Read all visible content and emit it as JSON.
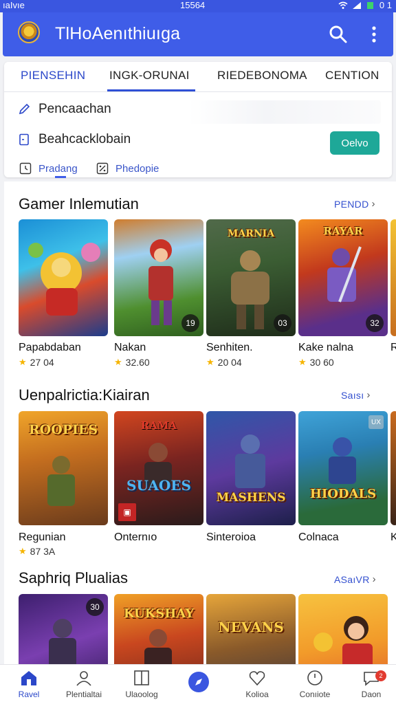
{
  "status_bar": {
    "left": "ıaIvıe",
    "center": "15564",
    "right": "0 1"
  },
  "app_bar": {
    "title": "TlHoAenıthiuıga"
  },
  "tabs": [
    "PIENSEHIN",
    "INGK-ORUNAI",
    "RIEDEBONOMA",
    "CENTION"
  ],
  "menu": {
    "row1": "Pencaachan",
    "row2": "Beahcacklobain",
    "go_button": "Oelvo",
    "sub1": "Pradang",
    "sub2": "Phedopie"
  },
  "sections": [
    {
      "title": "Gamer Inlemutian",
      "link": "PENDD",
      "cards": [
        {
          "name": "Papabdaban",
          "rating": "27 04",
          "badge": ""
        },
        {
          "name": "Nakan",
          "rating": "32.60",
          "badge": "19"
        },
        {
          "name": "Senhiten.",
          "rating": "20 04",
          "badge": "03"
        },
        {
          "name": "Kake nalna",
          "rating": "30 60",
          "badge": "32"
        },
        {
          "name": "R",
          "rating": "",
          "badge": ""
        }
      ]
    },
    {
      "title": "Uenpalrictia:Kiairan",
      "link": "Saısı",
      "cards": [
        {
          "name": "Regunian",
          "rating": "87 3A",
          "art": "ROOPIES",
          "badge": ""
        },
        {
          "name": "Onternıo",
          "rating": "",
          "art": "SUAOES",
          "badge": ""
        },
        {
          "name": "Sinteroioa",
          "rating": "",
          "art": "MASHENS",
          "badge": ""
        },
        {
          "name": "Colnaca",
          "rating": "",
          "art": "HIODALS",
          "badge": "UX"
        },
        {
          "name": "K",
          "rating": "",
          "badge": ""
        }
      ]
    },
    {
      "title": "Saphriq Plualias",
      "link": "ASaıVR",
      "cards": [
        {
          "name": "",
          "rating": "",
          "badge": "30"
        },
        {
          "name": "",
          "rating": "",
          "art": "KUKSHAY",
          "badge": ""
        },
        {
          "name": "",
          "rating": "",
          "art": "NEVANS",
          "badge": ""
        },
        {
          "name": "",
          "rating": "",
          "badge": ""
        }
      ]
    }
  ],
  "bottom_nav": [
    "Ravel",
    "Plentialtai",
    "Ulaoolog",
    "",
    "Kolioa",
    "Conıiote",
    "Daon"
  ],
  "notif_count": "2",
  "colors": {
    "primary": "#3f5de8",
    "accent": "#1ea898",
    "star": "#f5b400"
  }
}
